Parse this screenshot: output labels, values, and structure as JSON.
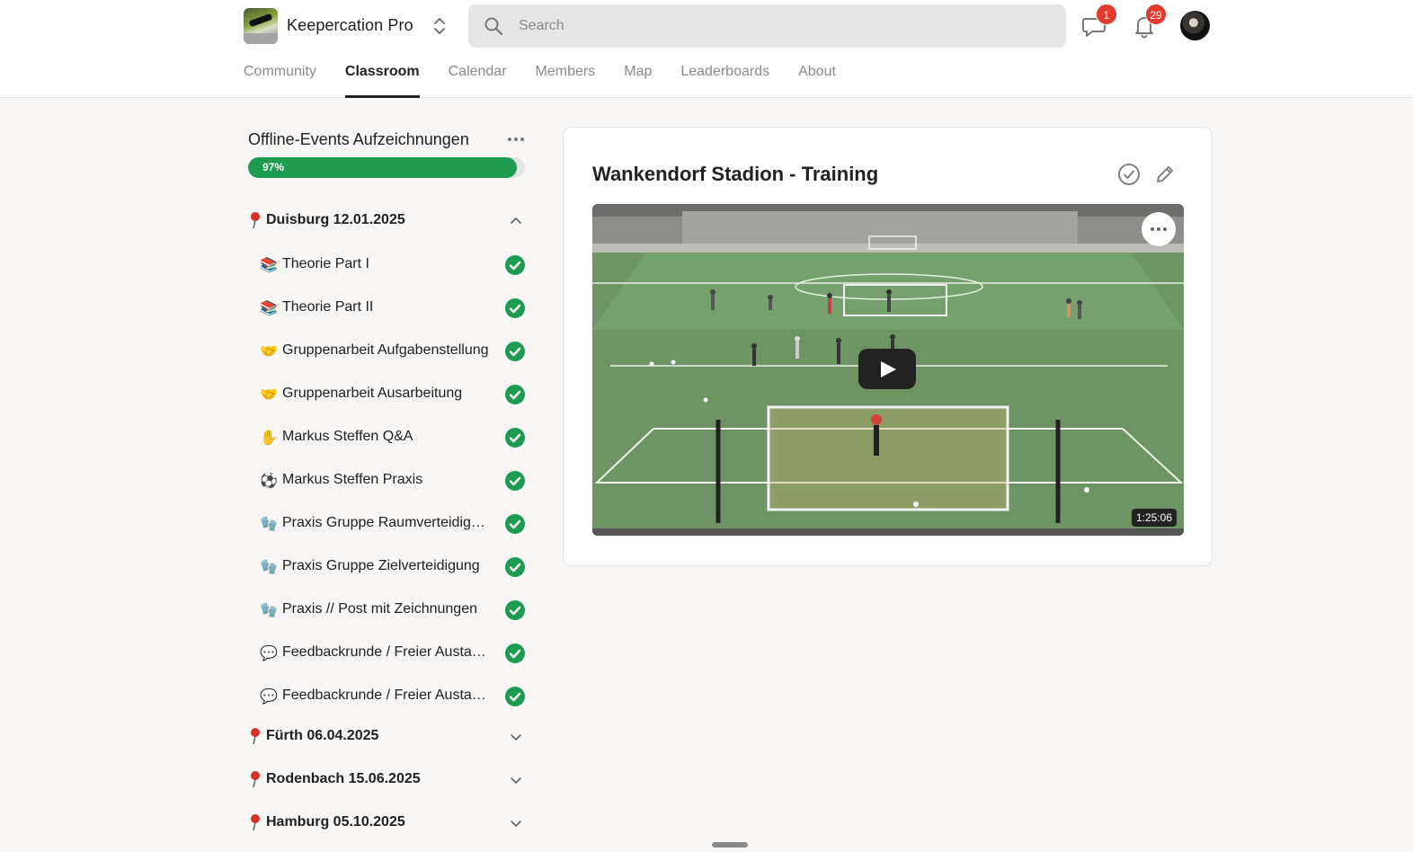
{
  "header": {
    "app_name": "Keepercation Pro",
    "search_placeholder": "Search",
    "chat_badge": "1",
    "notifications_badge": "29"
  },
  "nav": {
    "tabs": [
      {
        "label": "Community",
        "active": false
      },
      {
        "label": "Classroom",
        "active": true
      },
      {
        "label": "Calendar",
        "active": false
      },
      {
        "label": "Members",
        "active": false
      },
      {
        "label": "Map",
        "active": false
      },
      {
        "label": "Leaderboards",
        "active": false
      },
      {
        "label": "About",
        "active": false
      }
    ]
  },
  "course": {
    "title": "Offline-Events Aufzeichnungen",
    "progress_label": "97%",
    "progress_value": 0.97
  },
  "sections": [
    {
      "title": "Duisburg 12.01.2025",
      "expanded": true,
      "lessons": [
        {
          "emoji": "📚",
          "icon": "books-icon",
          "label": "Theorie Part I",
          "done": true
        },
        {
          "emoji": "📚",
          "icon": "books-icon",
          "label": "Theorie Part II",
          "done": true
        },
        {
          "emoji": "🤝",
          "icon": "handshake-icon",
          "label": "Gruppenarbeit Aufgabenstellung",
          "done": true
        },
        {
          "emoji": "🤝",
          "icon": "handshake-icon",
          "label": "Gruppenarbeit Ausarbeitung",
          "done": true
        },
        {
          "emoji": "✋",
          "icon": "raised-hand-icon",
          "label": "Markus Steffen Q&A",
          "done": true
        },
        {
          "emoji": "⚽",
          "icon": "soccer-ball-icon",
          "label": "Markus Steffen Praxis",
          "done": true
        },
        {
          "emoji": "🧤",
          "icon": "gloves-icon",
          "label": "Praxis Gruppe Raumverteidigu…",
          "done": true
        },
        {
          "emoji": "🧤",
          "icon": "gloves-icon",
          "label": "Praxis Gruppe Zielverteidigung",
          "done": true
        },
        {
          "emoji": "🧤",
          "icon": "gloves-icon",
          "label": "Praxis // Post mit Zeichnungen",
          "done": true
        },
        {
          "emoji": "💬",
          "icon": "speech-bubble-icon",
          "label": "Feedbackrunde / Freier Austau…",
          "done": true
        },
        {
          "emoji": "💬",
          "icon": "speech-bubble-icon",
          "label": "Feedbackrunde / Freier Austau…",
          "done": true
        }
      ]
    },
    {
      "title": "Fürth 06.04.2025",
      "expanded": false
    },
    {
      "title": "Rodenbach 15.06.2025",
      "expanded": false
    },
    {
      "title": "Hamburg 05.10.2025",
      "expanded": false
    }
  ],
  "lesson": {
    "title": "Wankendorf Stadion - Training",
    "video_duration": "1:25:06"
  },
  "colors": {
    "accent_green": "#1d9b51",
    "badge_red": "#e03b2e",
    "pin_red": "#d93025"
  }
}
